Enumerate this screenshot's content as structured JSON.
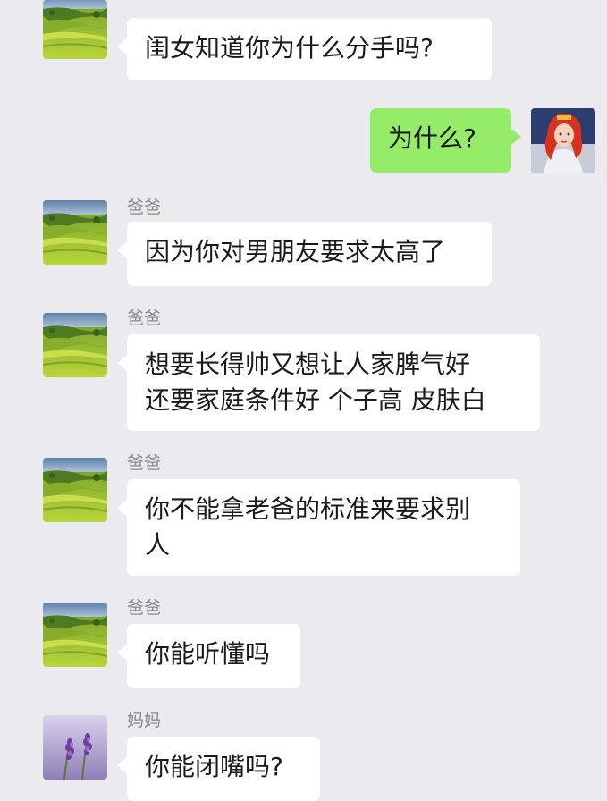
{
  "messages": [
    {
      "sender": "",
      "text": "闺女知道你为什么分手吗?",
      "avatar": "landscape-icon",
      "direction": "in"
    },
    {
      "sender": "",
      "text": "为什么?",
      "avatar": "princess-avatar-icon",
      "direction": "out"
    },
    {
      "sender": "爸爸",
      "text": "因为你对男朋友要求太高了",
      "avatar": "landscape-icon",
      "direction": "in"
    },
    {
      "sender": "爸爸",
      "line1": "想要长得帅又想让人家脾气好",
      "line2": "还要家庭条件好 个子高 皮肤白",
      "avatar": "landscape-icon",
      "direction": "in"
    },
    {
      "sender": "爸爸",
      "line1": "你不能拿老爸的标准来要求别",
      "line2": "人",
      "avatar": "landscape-icon",
      "direction": "in"
    },
    {
      "sender": "爸爸",
      "text": "你能听懂吗",
      "avatar": "landscape-icon",
      "direction": "in"
    },
    {
      "sender": "妈妈",
      "text": "你能闭嘴吗?",
      "avatar": "lavender-icon",
      "direction": "in"
    }
  ],
  "colors": {
    "background": "#ebeaee",
    "incoming_bubble": "#ffffff",
    "outgoing_bubble": "#95ec69",
    "sender_name": "#8a8a8a"
  }
}
